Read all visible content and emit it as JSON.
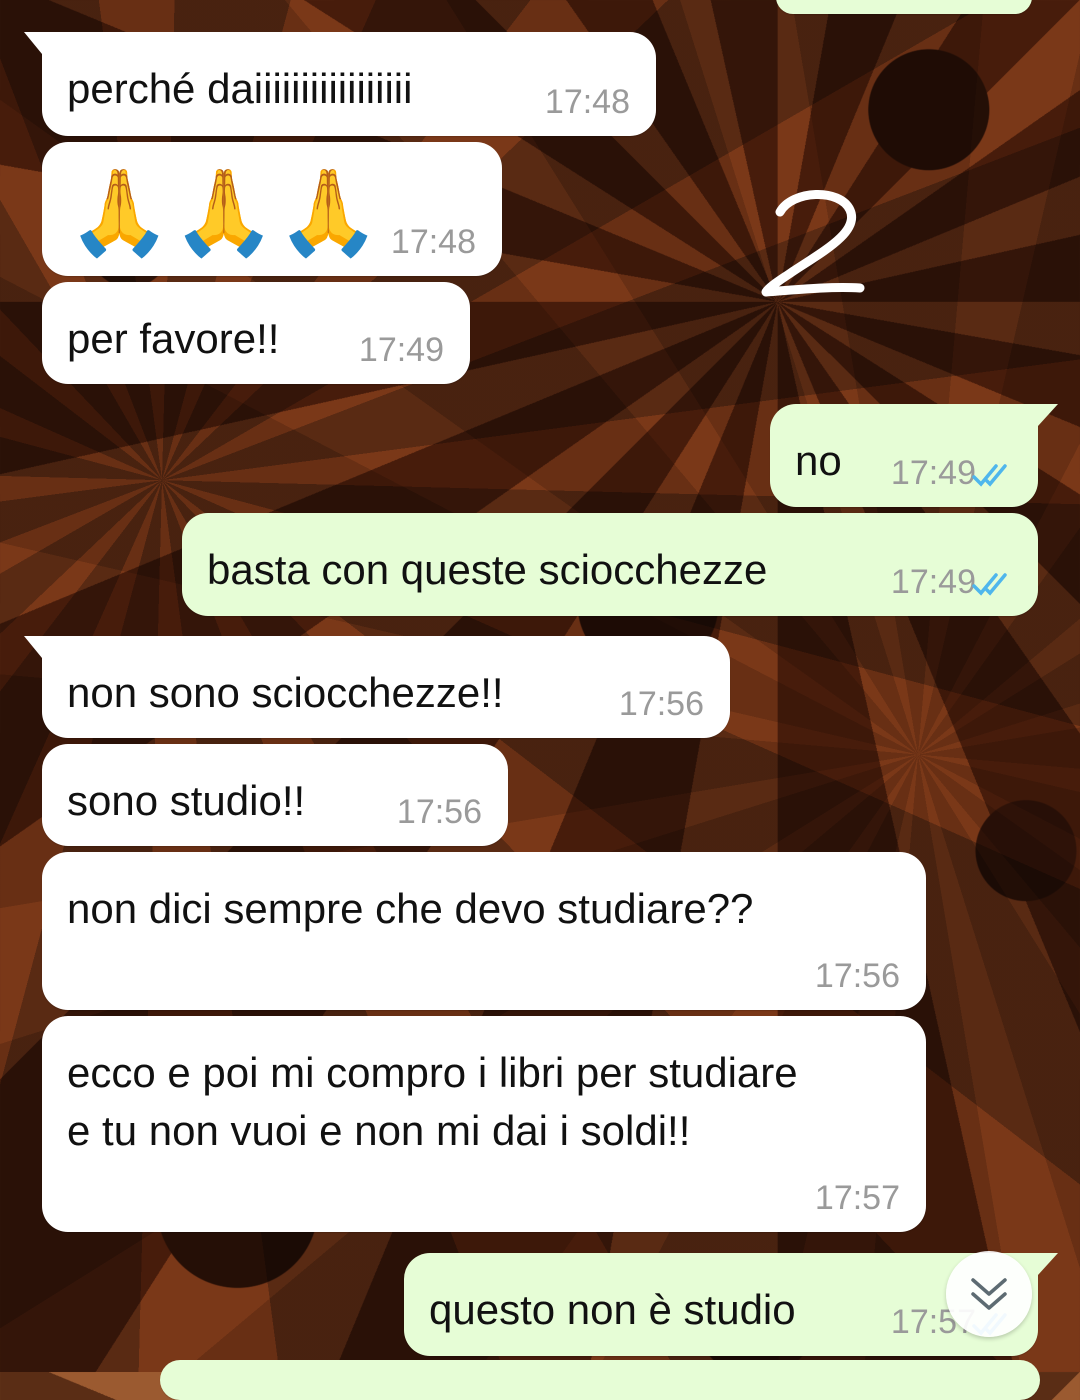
{
  "theme": {
    "incoming_bg": "#ffffff",
    "outgoing_bg": "#e6fdd6",
    "time_color": "#9a9a9a",
    "read_tick_color": "#4fb6ec",
    "wallpaper": "star anise photo"
  },
  "messages": [
    {
      "direction": "incoming",
      "text": "perché daiiiiiiiiiiiiiiiii",
      "time": "17:48"
    },
    {
      "direction": "incoming",
      "text": "🙏🙏🙏",
      "time": "17:48"
    },
    {
      "direction": "incoming",
      "text": "per favore!!",
      "time": "17:49"
    },
    {
      "direction": "outgoing",
      "text": "no",
      "time": "17:49",
      "status": "read"
    },
    {
      "direction": "outgoing",
      "text": "basta con queste sciocchezze",
      "time": "17:49",
      "status": "read"
    },
    {
      "direction": "incoming",
      "text": "non sono sciocchezze!!",
      "time": "17:56"
    },
    {
      "direction": "incoming",
      "text": "sono studio!!",
      "time": "17:56"
    },
    {
      "direction": "incoming",
      "text": "non dici sempre che devo studiare??",
      "time": "17:56"
    },
    {
      "direction": "incoming",
      "text": "ecco e poi mi compro i libri per studiare\ne tu non vuoi e non mi dai i soldi!!",
      "time": "17:57"
    },
    {
      "direction": "outgoing",
      "text": "questo non è studio",
      "time": "17:57",
      "status": "read"
    }
  ],
  "overlay": {
    "scroll_button_icon": "double-chevron-down-icon",
    "doodle_icon": "handwritten-2-annotation"
  }
}
